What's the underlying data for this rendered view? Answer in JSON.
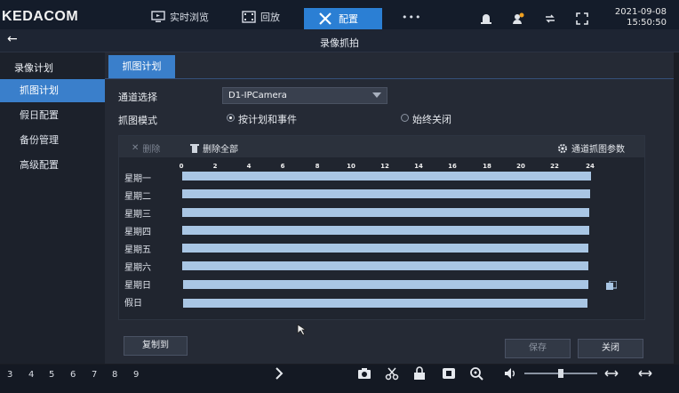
{
  "brand": "KEDACOM",
  "top_nav": {
    "live_label": "实时浏览",
    "playback_label": "回放",
    "config_label": "配置",
    "more_label": "•••"
  },
  "clock": {
    "date": "2021-09-08",
    "time": "15:50:50"
  },
  "page_title": "录像抓拍",
  "sidebar": {
    "title": "录像计划",
    "items": [
      {
        "label": "抓图计划",
        "active": true
      },
      {
        "label": "假日配置"
      },
      {
        "label": "备份管理"
      },
      {
        "label": "高级配置"
      }
    ]
  },
  "tab": {
    "label": "抓图计划"
  },
  "form": {
    "channel_label": "通道选择",
    "channel_value": "D1-IPCamera",
    "mode_label": "抓图模式",
    "mode_option_1": "按计划和事件",
    "mode_option_2": "始终关闭",
    "mode_selected": 1
  },
  "schedule": {
    "delete_label": "删除",
    "delete_all_label": "删除全部",
    "channel_params_label": "通道抓图参数",
    "hours": [
      "0",
      "2",
      "4",
      "6",
      "8",
      "10",
      "12",
      "14",
      "16",
      "18",
      "20",
      "22",
      "24"
    ],
    "days": [
      "星期一",
      "星期二",
      "星期三",
      "星期四",
      "星期五",
      "星期六",
      "星期日",
      "假日"
    ]
  },
  "buttons": {
    "copy_label": "复制到",
    "save_label": "保存",
    "close_label": "关闭"
  },
  "footer": {
    "numbers": [
      "3",
      "4",
      "5",
      "6",
      "7",
      "8",
      "9"
    ]
  },
  "colors": {
    "accent": "#3a7fcb",
    "bar": "#a9c6e4"
  }
}
